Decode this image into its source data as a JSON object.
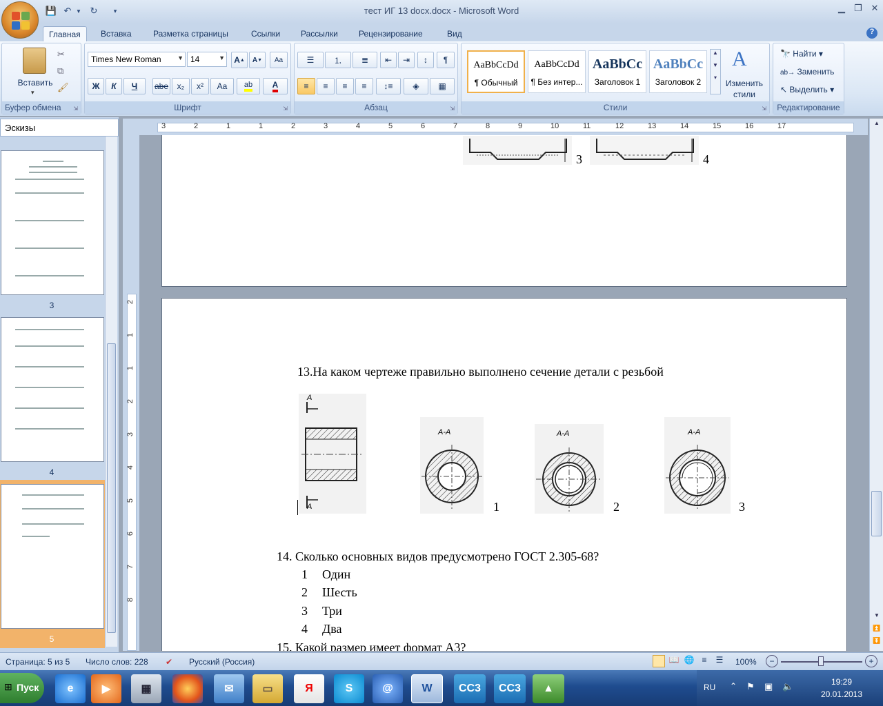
{
  "app": {
    "title": "тест ИГ 13 docx.docx - Microsoft Word"
  },
  "tabs": [
    "Главная",
    "Вставка",
    "Разметка страницы",
    "Ссылки",
    "Рассылки",
    "Рецензирование",
    "Вид"
  ],
  "ribbon": {
    "clipboard": {
      "paste_label": "Вставить",
      "group_label": "Буфер обмена"
    },
    "font": {
      "family": "Times New Roman",
      "size": "14",
      "group_label": "Шрифт",
      "bold": "Ж",
      "italic": "К",
      "underline": "Ч",
      "strike": "abe",
      "sub": "x₂",
      "sup": "x²",
      "case": "Aa"
    },
    "paragraph": {
      "group_label": "Абзац"
    },
    "styles": {
      "group_label": "Стили",
      "items": [
        {
          "preview": "AaBbCcDd",
          "name": "¶ Обычный"
        },
        {
          "preview": "AaBbCcDd",
          "name": "¶ Без интер..."
        },
        {
          "preview": "AaBbCc",
          "name": "Заголовок 1"
        },
        {
          "preview": "AaBbCc",
          "name": "Заголовок 2"
        }
      ],
      "change_label_1": "Изменить",
      "change_label_2": "стили"
    },
    "editing": {
      "find": "Найти",
      "replace": "Заменить",
      "select": "Выделить",
      "group_label": "Редактирование"
    }
  },
  "navpane": {
    "title": "Эскизы",
    "pages": [
      "3",
      "4",
      "5"
    ]
  },
  "document": {
    "prev_page_labels": [
      "3",
      "4"
    ],
    "q13": "13.На каком чертеже правильно выполнено сечение детали с резьбой",
    "section_labels": [
      "А-А",
      "А-А",
      "А-А"
    ],
    "view_marks": [
      "А",
      "А"
    ],
    "variant_labels": [
      "1",
      "2",
      "3"
    ],
    "q14": "14.   Сколько основных видов предусмотрено ГОСТ 2.305-68?",
    "q14_options": [
      {
        "n": "1",
        "text": "Один"
      },
      {
        "n": "2",
        "text": "Шесть"
      },
      {
        "n": "3",
        "text": "Три"
      },
      {
        "n": "4",
        "text": "Два"
      }
    ],
    "q15": "15. Какой размер имеет формат А3?"
  },
  "ruler": {
    "h_ticks": [
      "3",
      "2",
      "1",
      "1",
      "2",
      "3",
      "4",
      "5",
      "6",
      "7",
      "8",
      "9",
      "10",
      "11",
      "12",
      "13",
      "14",
      "15",
      "16",
      "17"
    ],
    "v_ticks": [
      "2",
      "1",
      "1",
      "2",
      "3",
      "4",
      "5",
      "6",
      "7",
      "8"
    ]
  },
  "statusbar": {
    "page": "Страница: 5 из 5",
    "words": "Число слов: 228",
    "language": "Русский (Россия)",
    "zoom": "100%"
  },
  "taskbar": {
    "start": "Пуск",
    "lang": "RU",
    "time": "19:29",
    "date": "20.01.2013",
    "cc_label": "CC3"
  },
  "colors": {
    "accent": "#15325e",
    "highlight": "#ffff00",
    "font_color": "#e00000"
  }
}
